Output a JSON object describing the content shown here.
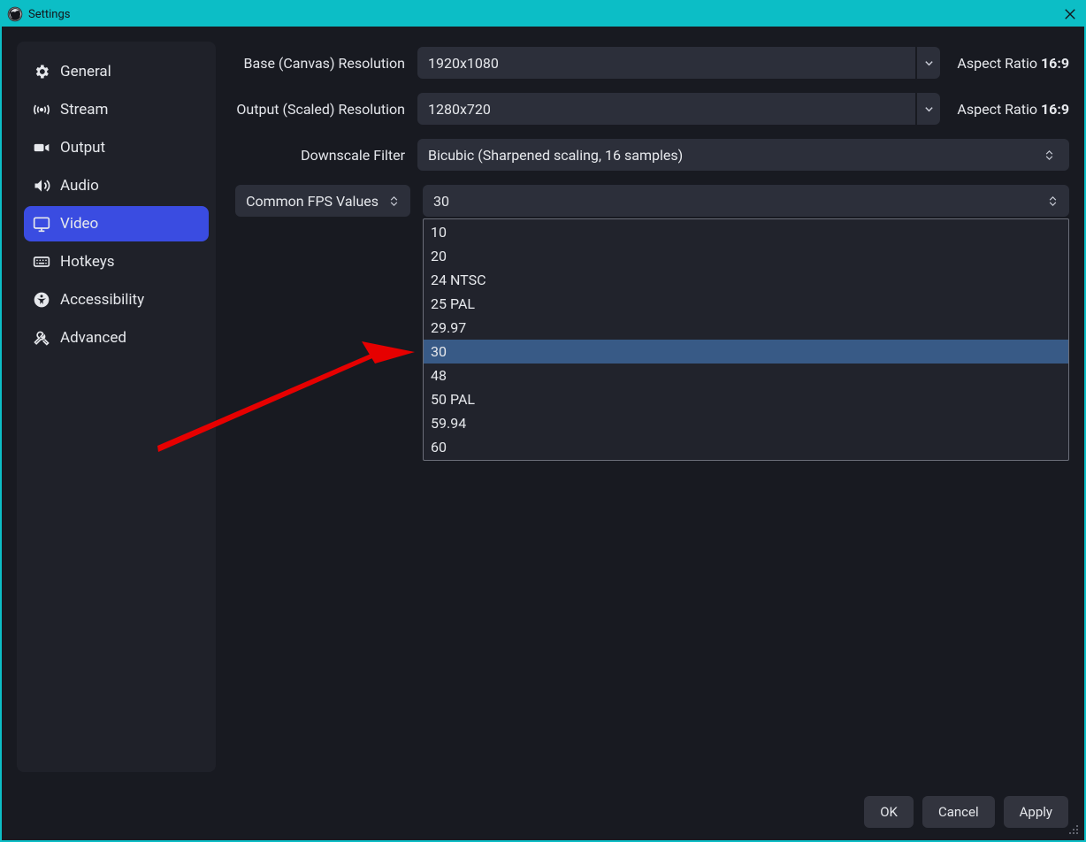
{
  "window": {
    "title": "Settings"
  },
  "sidebar": {
    "items": [
      {
        "label": "General"
      },
      {
        "label": "Stream"
      },
      {
        "label": "Output"
      },
      {
        "label": "Audio"
      },
      {
        "label": "Video"
      },
      {
        "label": "Hotkeys"
      },
      {
        "label": "Accessibility"
      },
      {
        "label": "Advanced"
      }
    ],
    "active_index": 4
  },
  "video": {
    "base_label": "Base (Canvas) Resolution",
    "base_value": "1920x1080",
    "base_aspect_label": "Aspect Ratio",
    "base_aspect_value": "16:9",
    "output_label": "Output (Scaled) Resolution",
    "output_value": "1280x720",
    "output_aspect_label": "Aspect Ratio",
    "output_aspect_value": "16:9",
    "filter_label": "Downscale Filter",
    "filter_value": "Bicubic (Sharpened scaling, 16 samples)",
    "fps_mode_label": "Common FPS Values",
    "fps_value": "30",
    "fps_options": [
      "10",
      "20",
      "24 NTSC",
      "25 PAL",
      "29.97",
      "30",
      "48",
      "50 PAL",
      "59.94",
      "60"
    ],
    "fps_selected_index": 5
  },
  "footer": {
    "ok": "OK",
    "cancel": "Cancel",
    "apply": "Apply"
  }
}
